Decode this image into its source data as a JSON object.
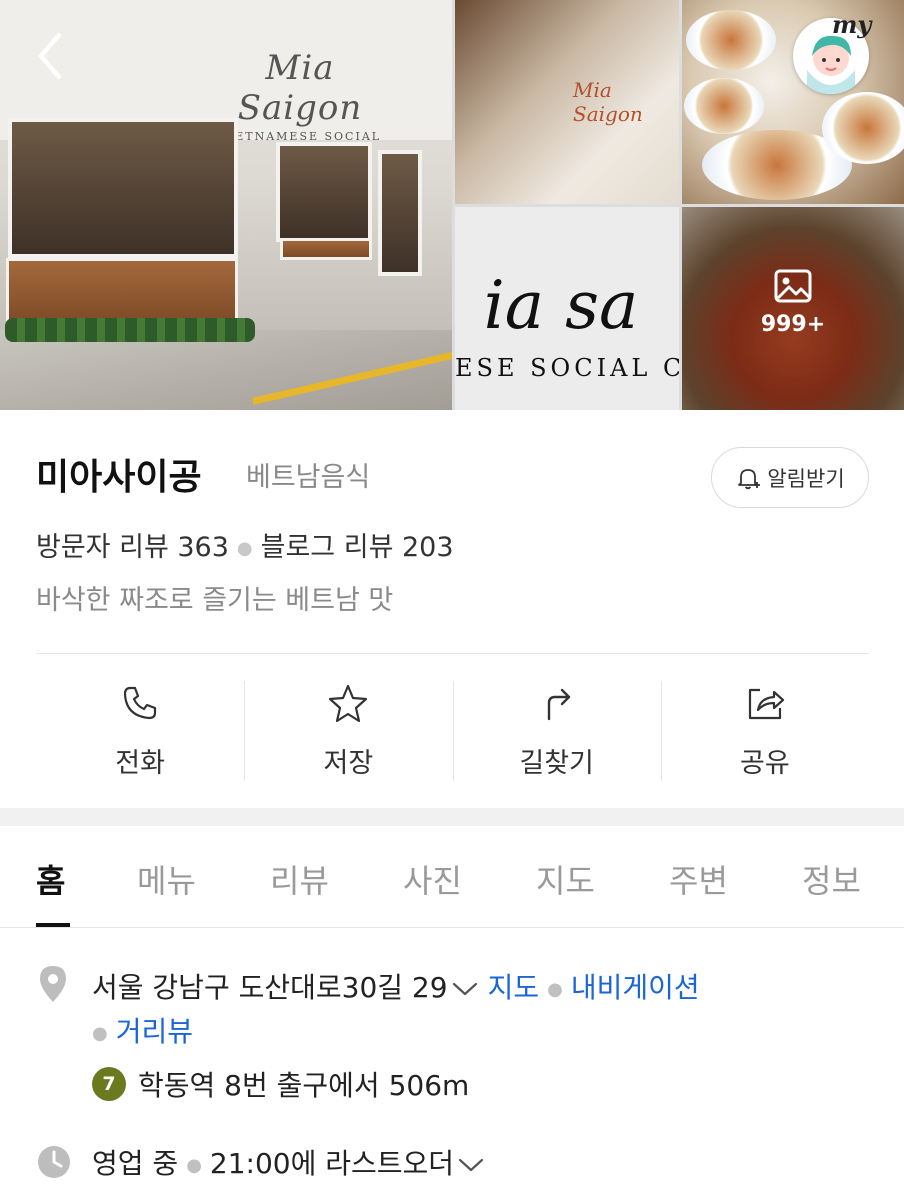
{
  "gallery": {
    "main_logo_title": "Mia Saigon",
    "main_logo_sub": "VIETNAMESE SOCIAL CLUB",
    "interior_sign": "Mia Saigon",
    "logo_closeup_title": "ia sa",
    "logo_closeup_sub": "ESE SOCIAL CLU",
    "photo_count": "999+",
    "icons": {
      "back": "chevron-left-icon",
      "photos": "image-icon"
    }
  },
  "profile": {
    "badge_text": "my"
  },
  "place": {
    "name": "미아사이공",
    "category": "베트남음식",
    "alarm_label": "알림받기",
    "visitor_reviews": "방문자 리뷰 363",
    "blog_reviews": "블로그 리뷰 203",
    "description": "바삭한 짜조로 즐기는 베트남 맛"
  },
  "actions": [
    {
      "label": "전화",
      "icon": "phone-icon"
    },
    {
      "label": "저장",
      "icon": "star-icon"
    },
    {
      "label": "길찾기",
      "icon": "directions-icon"
    },
    {
      "label": "공유",
      "icon": "share-icon"
    }
  ],
  "tabs": [
    "홈",
    "메뉴",
    "리뷰",
    "사진",
    "지도",
    "주변",
    "정보"
  ],
  "active_tab": "홈",
  "details": {
    "address": "서울 강남구 도산대로30길 29",
    "map_link": "지도",
    "navigation_link": "내비게이션",
    "street_view_link": "거리뷰",
    "subway_line": "7",
    "subway_text": "학동역 8번 출구에서 506m",
    "status": "영업 중",
    "last_order": "21:00에 라스트오더"
  },
  "colors": {
    "link_blue": "#1a66d6",
    "line7_olive": "#6b7a1f",
    "text_gray": "#8a8a8a"
  }
}
